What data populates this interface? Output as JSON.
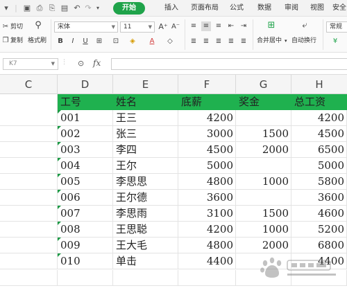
{
  "menu": {
    "arrow": "▾",
    "tabs": [
      "开始",
      "插入",
      "页面布局",
      "公式",
      "数据",
      "审阅",
      "视图",
      "安全"
    ]
  },
  "ribbon": {
    "cut_label": "剪切",
    "copy_label": "复制",
    "format_painter_label": "格式刷",
    "font_name": "宋体",
    "font_size": "11",
    "merge_label": "合并居中",
    "wrap_label": "自动换行",
    "number_format": "常规"
  },
  "formula_bar": {
    "cell_ref": "K7",
    "fx": "fx",
    "value": ""
  },
  "columns": [
    "C",
    "D",
    "E",
    "F",
    "G",
    "H"
  ],
  "table": {
    "headers": [
      "工号",
      "姓名",
      "底薪",
      "奖金",
      "总工资"
    ],
    "rows": [
      [
        "001",
        "王三",
        "4200",
        "",
        "4200"
      ],
      [
        "002",
        "张三",
        "3000",
        "1500",
        "4500"
      ],
      [
        "003",
        "李四",
        "4500",
        "2000",
        "6500"
      ],
      [
        "004",
        "王尔",
        "5000",
        "",
        "5000"
      ],
      [
        "005",
        "李思思",
        "4800",
        "1000",
        "5800"
      ],
      [
        "006",
        "王尔德",
        "3600",
        "",
        "3600"
      ],
      [
        "007",
        "李思雨",
        "3100",
        "1500",
        "4600"
      ],
      [
        "008",
        "王思聪",
        "4200",
        "1000",
        "5200"
      ],
      [
        "009",
        "王大毛",
        "4800",
        "2000",
        "6800"
      ],
      [
        "010",
        "单击",
        "4400",
        "",
        "4400"
      ]
    ]
  },
  "colors": {
    "accent": "#1fa34a",
    "header_fill": "#1fb14f"
  }
}
